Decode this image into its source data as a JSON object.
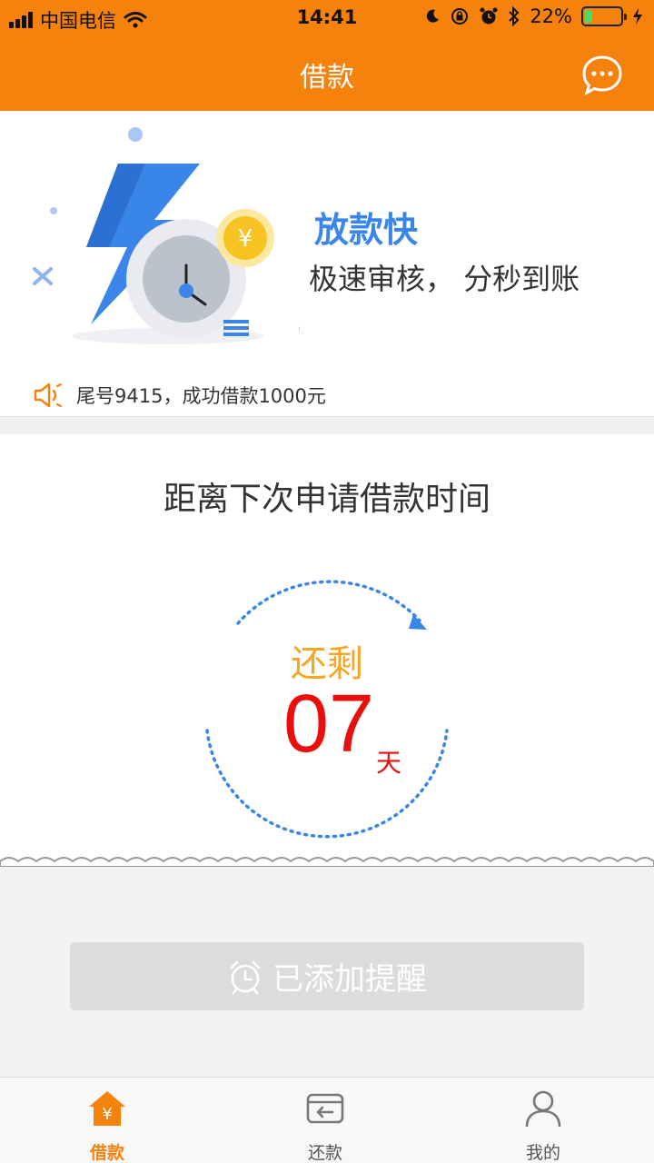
{
  "status_bar": {
    "carrier": "中国电信",
    "time": "14:41",
    "battery": "22%",
    "battery_level": 0.22
  },
  "nav": {
    "title": "借款",
    "menu_icon": "chat-bubble-icon"
  },
  "banner": {
    "title": "放款快",
    "subtitle": "极速审核， 分秒到账",
    "notice": "尾号9415，成功借款1000元",
    "coin_symbol": "¥"
  },
  "countdown": {
    "heading": "距离下次申请借款时间",
    "label": "还剩",
    "value": "07",
    "unit": "天"
  },
  "reminder_button": {
    "label": "已添加提醒",
    "icon": "alarm-clock-icon"
  },
  "tabs": [
    {
      "label": "借款",
      "icon": "home-yen-icon",
      "active": true
    },
    {
      "label": "还款",
      "icon": "card-return-icon",
      "active": false
    },
    {
      "label": "我的",
      "icon": "person-icon",
      "active": false
    }
  ],
  "colors": {
    "accent": "#f5820c",
    "promo_blue": "#3a86e8",
    "countdown_red": "#e8100c",
    "label_yellow": "#f5a623"
  }
}
